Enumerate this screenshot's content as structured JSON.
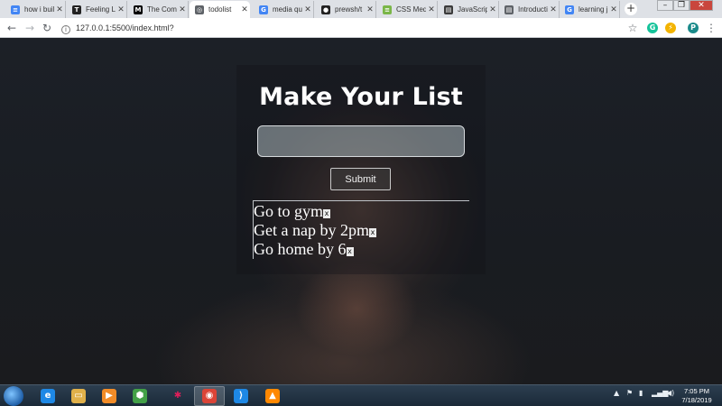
{
  "browser": {
    "tabs": [
      {
        "label": "how i buil",
        "icon": "docs-icon",
        "color": "#4285f4",
        "glyph": "≡"
      },
      {
        "label": "Feeling La",
        "icon": "nyt-icon",
        "color": "#222222",
        "glyph": "T"
      },
      {
        "label": "The Comp",
        "icon": "medium-icon",
        "color": "#000000",
        "glyph": "M"
      },
      {
        "label": "todolist",
        "icon": "globe-icon",
        "color": "#5f6368",
        "glyph": "◎",
        "active": true
      },
      {
        "label": "media qu",
        "icon": "google-icon",
        "color": "#4285f4",
        "glyph": "G"
      },
      {
        "label": "prewsh/t",
        "icon": "github-icon",
        "color": "#222222",
        "glyph": "●"
      },
      {
        "label": "CSS Medi",
        "icon": "css-icon",
        "color": "#7ab648",
        "glyph": "≡"
      },
      {
        "label": "JavaScrip",
        "icon": "doc-icon",
        "color": "#3b3b3b",
        "glyph": "▤"
      },
      {
        "label": "Introducti",
        "icon": "doc-icon",
        "color": "#5f6368",
        "glyph": "▤"
      },
      {
        "label": "learning j",
        "icon": "google-icon",
        "color": "#4285f4",
        "glyph": "G"
      }
    ],
    "new_tab": "+",
    "url": "127.0.0.1:5500/index.html?"
  },
  "app": {
    "title": "Make Your List",
    "input_value": "",
    "submit_label": "Submit",
    "delete_glyph": "x",
    "items": [
      "Go to gym",
      "Get a nap by 2pm",
      "Go home by 6"
    ]
  },
  "taskbar": {
    "apps": [
      {
        "icon": "ie-icon",
        "color": "#1e88e5",
        "glyph": "e"
      },
      {
        "icon": "explorer-icon",
        "color": "#e0b04a",
        "glyph": "▭"
      },
      {
        "icon": "media-player-icon",
        "color": "#f28c28",
        "glyph": "▶"
      },
      {
        "icon": "node-icon",
        "color": "#43a047",
        "glyph": "⬢"
      },
      {
        "icon": "slack-icon",
        "color": "#ffffff",
        "glyph": "✱"
      },
      {
        "icon": "chrome-icon",
        "color": "#db4437",
        "glyph": "◉",
        "active": true
      },
      {
        "icon": "vscode-icon",
        "color": "#1e88e5",
        "glyph": "⟩"
      },
      {
        "icon": "vlc-icon",
        "color": "#ff8800",
        "glyph": "▲"
      }
    ],
    "time": "7:05 PM",
    "date": "7/18/2019"
  }
}
